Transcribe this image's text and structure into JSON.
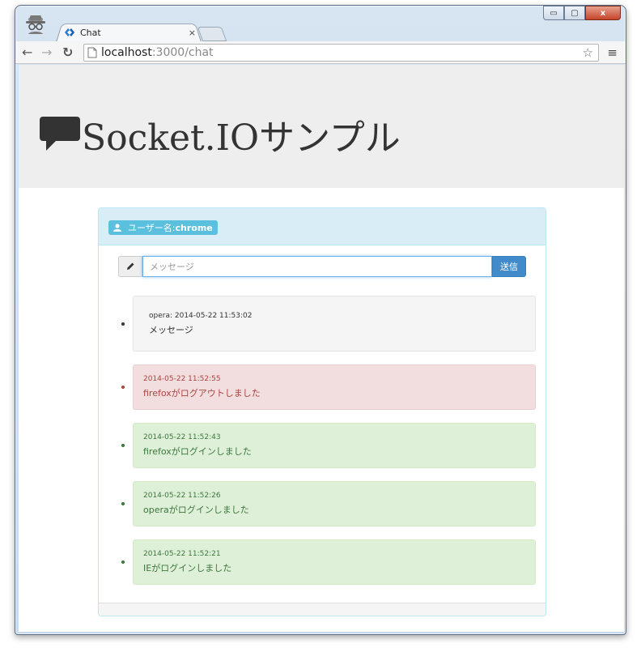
{
  "browser": {
    "tab_title": "Chat",
    "tab_close": "×",
    "url_host": "localhost",
    "url_path": ":3000/chat",
    "window_controls": {
      "minimize": "▭",
      "maximize": "▢",
      "close": "x"
    }
  },
  "page": {
    "title": "Socket.IOサンプル",
    "username_prefix": "ユーザー名:",
    "username": "chrome",
    "message_placeholder": "メッセージ",
    "send_label": "送信"
  },
  "messages": [
    {
      "type": "chat",
      "meta": "opera: 2014-05-22 11:53:02",
      "text": "メッセージ"
    },
    {
      "type": "logout",
      "meta": "2014-05-22 11:52:55",
      "text": "firefoxがログアウトしました"
    },
    {
      "type": "login",
      "meta": "2014-05-22 11:52:43",
      "text": "firefoxがログインしました"
    },
    {
      "type": "login",
      "meta": "2014-05-22 11:52:26",
      "text": "operaがログインしました"
    },
    {
      "type": "login",
      "meta": "2014-05-22 11:52:21",
      "text": "IEがログインしました"
    }
  ],
  "colors": {
    "info": "#5bc0de",
    "primary": "#428bca",
    "danger_text": "#a94442",
    "success_text": "#3c763d"
  }
}
